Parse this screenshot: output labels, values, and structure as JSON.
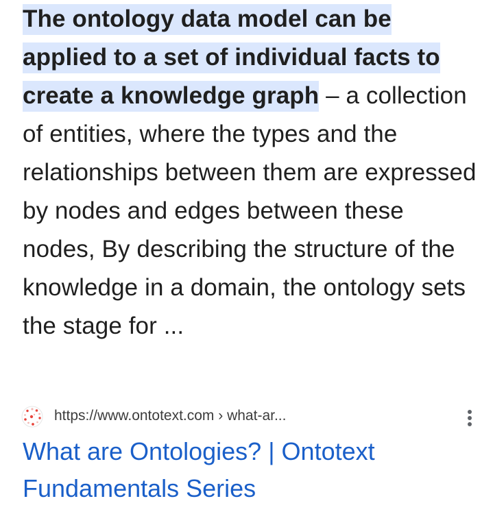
{
  "snippet": {
    "highlighted": "The ontology data model can be applied to a set of individual facts to create a knowledge graph",
    "rest": " – a collection of entities, where the types and the relationships between them are expressed by nodes and edges between these nodes, By describing the structure of the knowledge in a domain, the ontology sets the stage for ..."
  },
  "result": {
    "url": "https://www.ontotext.com › what-ar...",
    "title": "What are Ontologies? | Ontotext Fundamentals Series",
    "favicon_icon": "ontotext-logo-icon",
    "menu_icon": "more-vert-icon"
  },
  "colors": {
    "highlight": "#dbe7fd",
    "link": "#1a5fc9",
    "favicon_accent": "#e8453c"
  }
}
